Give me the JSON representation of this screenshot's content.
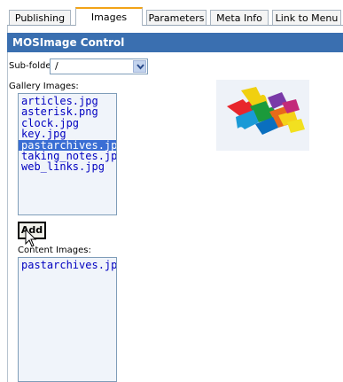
{
  "tabs": [
    {
      "label": "Publishing"
    },
    {
      "label": "Images"
    },
    {
      "label": "Parameters"
    },
    {
      "label": "Meta Info"
    },
    {
      "label": "Link to Menu"
    }
  ],
  "active_tab": "Images",
  "header": {
    "title": "MOSImage Control"
  },
  "subfolder": {
    "label": "Sub-folder:",
    "value": "/"
  },
  "gallery": {
    "label": "Gallery Images:",
    "items": [
      "articles.jpg",
      "asterisk.png",
      "clock.jpg",
      "key.jpg",
      "pastarchives.jpg",
      "taking_notes.jpg",
      "web_links.jpg"
    ],
    "selected": "pastarchives.jpg"
  },
  "add_button": {
    "label": "Add"
  },
  "content": {
    "label": "Content Images:",
    "items": [
      "pastarchives.jpg"
    ]
  },
  "colors": {
    "header_bg": "#3a6fb0",
    "tab_accent": "#f2a317",
    "selection": "#3a6ed4",
    "list_text": "#0000c0"
  }
}
